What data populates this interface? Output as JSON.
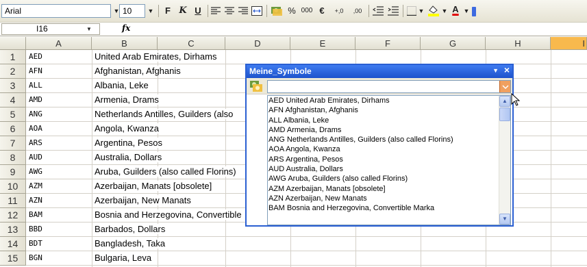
{
  "toolbar": {
    "font_name": "Arial",
    "font_size": "10",
    "bold": "F",
    "italic": "K",
    "underline": "U",
    "percent": "%",
    "thousands": "000",
    "currency": "€",
    "inc_decimals": "+,0",
    "dec_decimals": ",00"
  },
  "formula_bar": {
    "cell_ref": "I16",
    "fx": "fx"
  },
  "columns": [
    "A",
    "B",
    "C",
    "D",
    "E",
    "F",
    "G",
    "H",
    "I"
  ],
  "selected_column": "I",
  "rows": [
    {
      "num": "1",
      "code": "AED",
      "desc": "United Arab Emirates, Dirhams"
    },
    {
      "num": "2",
      "code": "AFN",
      "desc": "Afghanistan, Afghanis"
    },
    {
      "num": "3",
      "code": "ALL",
      "desc": "Albania, Leke"
    },
    {
      "num": "4",
      "code": "AMD",
      "desc": "Armenia, Drams"
    },
    {
      "num": "5",
      "code": "ANG",
      "desc": "Netherlands Antilles, Guilders (also"
    },
    {
      "num": "6",
      "code": "AOA",
      "desc": "Angola, Kwanza"
    },
    {
      "num": "7",
      "code": "ARS",
      "desc": "Argentina, Pesos"
    },
    {
      "num": "8",
      "code": "AUD",
      "desc": "Australia, Dollars"
    },
    {
      "num": "9",
      "code": "AWG",
      "desc": "Aruba, Guilders (also called Florins)"
    },
    {
      "num": "10",
      "code": "AZM",
      "desc": "Azerbaijan, Manats [obsolete]"
    },
    {
      "num": "11",
      "code": "AZN",
      "desc": "Azerbaijan, New Manats"
    },
    {
      "num": "12",
      "code": "BAM",
      "desc": "Bosnia and Herzegovina, Convertible"
    },
    {
      "num": "13",
      "code": "BBD",
      "desc": "Barbados, Dollars"
    },
    {
      "num": "14",
      "code": "BDT",
      "desc": "Bangladesh, Taka"
    },
    {
      "num": "15",
      "code": "BGN",
      "desc": "Bulgaria, Leva"
    }
  ],
  "palette": {
    "title": "Meine_Symbole",
    "close": "×",
    "menu": "▼",
    "combo_value": "",
    "list": [
      "AED United Arab Emirates, Dirhams",
      "AFN Afghanistan, Afghanis",
      "ALL Albania, Leke",
      "AMD Armenia, Drams",
      "ANG Netherlands Antilles, Guilders (also called Florins)",
      "AOA Angola, Kwanza",
      "ARS Argentina, Pesos",
      "AUD Australia, Dollars",
      "AWG Aruba, Guilders (also called Florins)",
      "AZM Azerbaijan, Manats [obsolete]",
      "AZN Azerbaijan, New Manats",
      "BAM Bosnia and Herzegovina, Convertible Marka"
    ]
  },
  "colors": {
    "title_bar": "#2a5fd2",
    "selected_column": "#f8b94d",
    "combo_button": "#f0a060"
  }
}
